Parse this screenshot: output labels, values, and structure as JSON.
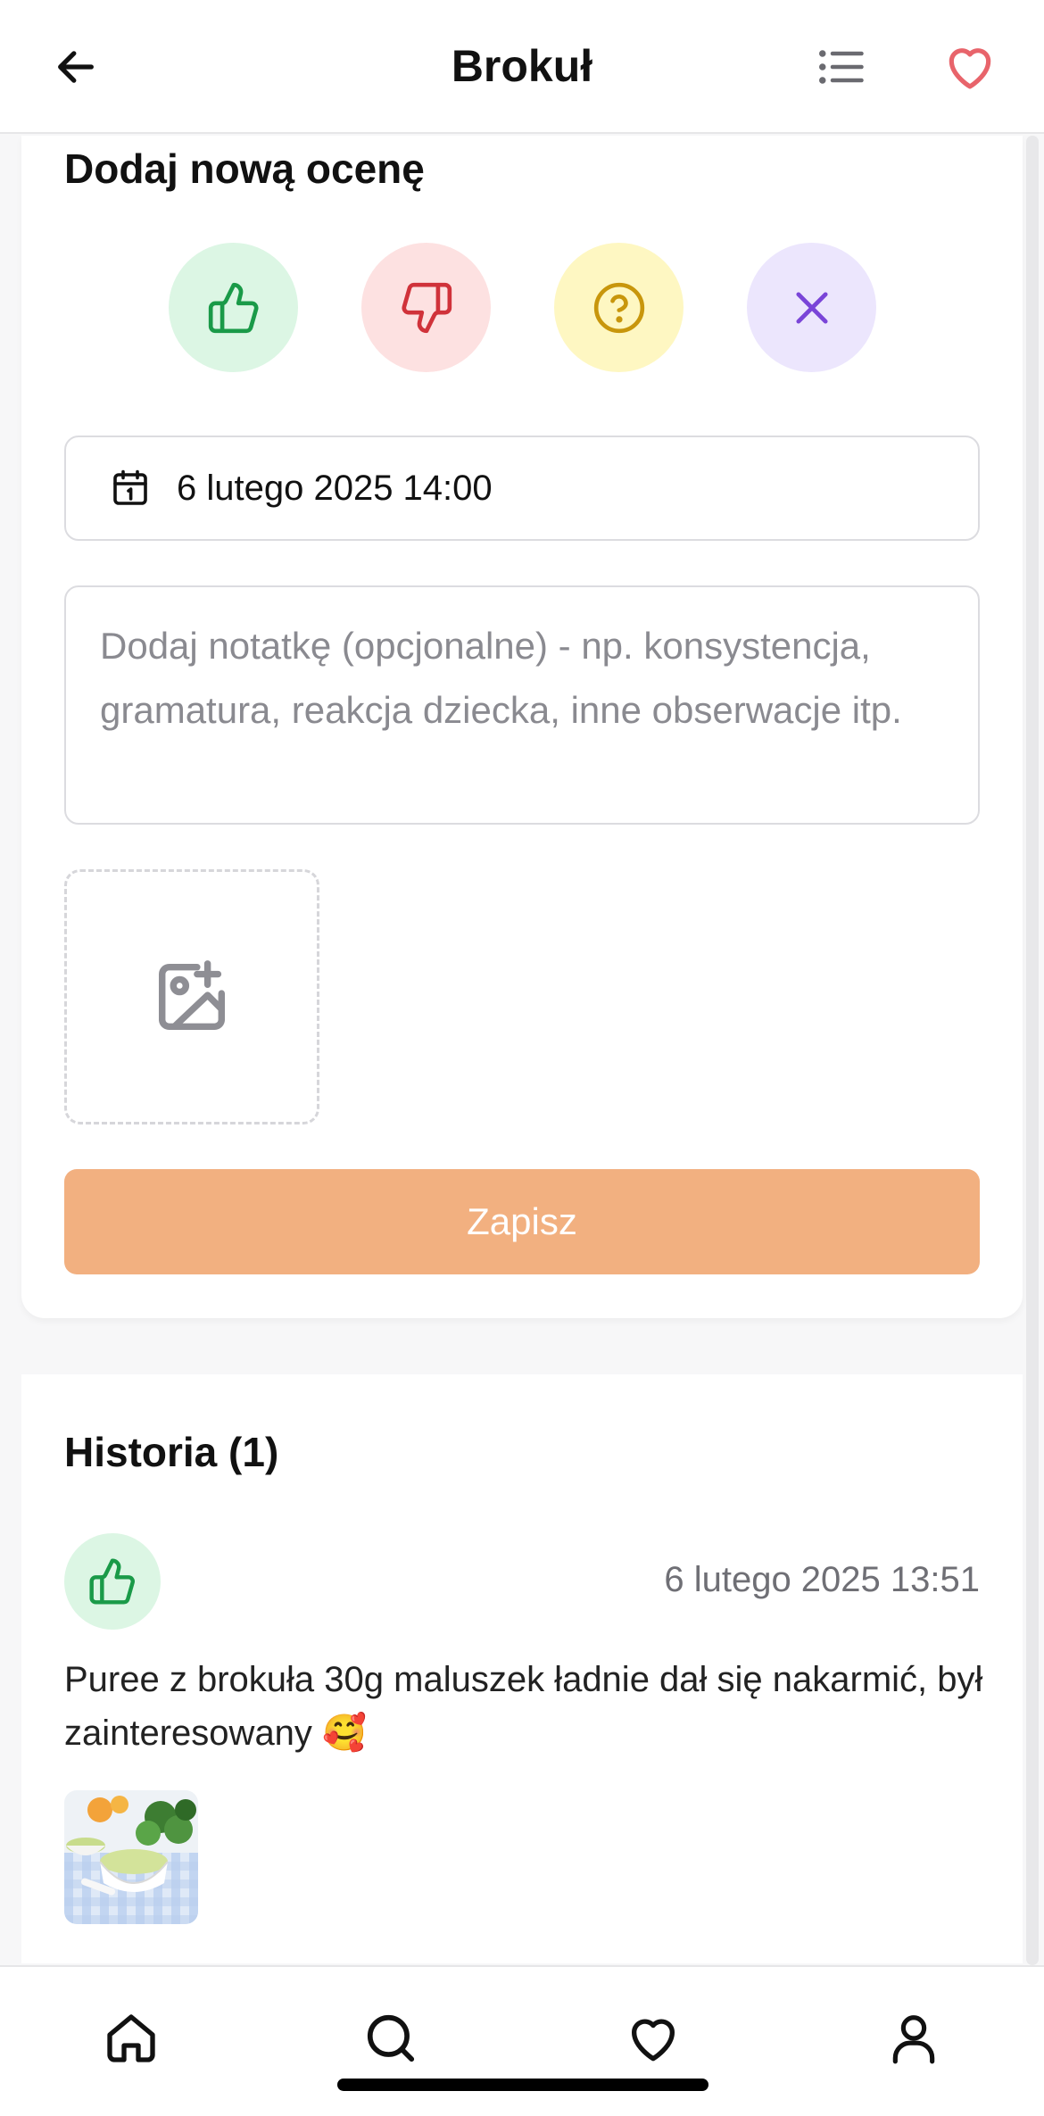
{
  "header": {
    "title": "Brokuł",
    "back_icon": "arrow-left-icon",
    "list_icon": "list-icon",
    "favorite_icon": "heart-outline-icon",
    "favorite_color": "#e8646b"
  },
  "new_rating": {
    "title": "Dodaj nową ocenę",
    "options": [
      {
        "icon": "thumbs-up-icon",
        "bg": "#dcf6e4",
        "color": "#1a9a48"
      },
      {
        "icon": "thumbs-down-icon",
        "bg": "#fde1e1",
        "color": "#d0323a"
      },
      {
        "icon": "question-circle-icon",
        "bg": "#fef7c2",
        "color": "#c8960c"
      },
      {
        "icon": "x-icon",
        "bg": "#ece6fd",
        "color": "#7a45d8"
      }
    ],
    "date_value": "6 lutego 2025 14:00",
    "note_placeholder": "Dodaj notatkę (opcjonalne) - np. konsystencja, gramatura, reakcja dziecka, inne obserwacje itp.",
    "photo_icon": "image-plus-icon",
    "save_label": "Zapisz",
    "save_color": "#f2b080"
  },
  "history": {
    "title": "Historia (1)",
    "entries": [
      {
        "rating_icon": "thumbs-up-icon",
        "date": "6 lutego 2025 13:51",
        "note": "Puree z brokuła 30g maluszek ładnie dał się nakarmić, był zainteresowany 🥰",
        "photo": "broccoli-puree-photo"
      }
    ]
  },
  "bottom_nav": {
    "items": [
      {
        "icon": "home-icon"
      },
      {
        "icon": "search-icon"
      },
      {
        "icon": "heart-icon"
      },
      {
        "icon": "user-icon"
      }
    ]
  }
}
